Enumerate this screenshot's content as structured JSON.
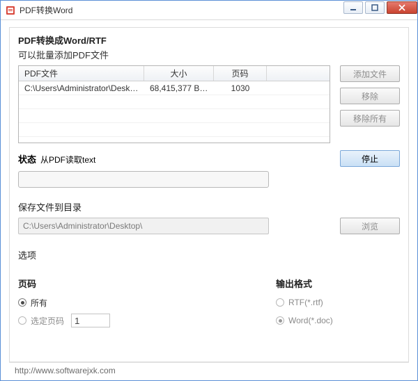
{
  "window": {
    "title": "PDF转换Word"
  },
  "header": {
    "title": "PDF转换成Word/RTF",
    "subtitle": "可以批量添加PDF文件"
  },
  "table": {
    "columns": {
      "file": "PDF文件",
      "size": "大小",
      "page": "页码"
    },
    "rows": [
      {
        "file": "C:\\Users\\Administrator\\Deskto...",
        "size": "68,415,377 Byte",
        "page": "1030"
      }
    ]
  },
  "buttons": {
    "add": "添加文件",
    "remove": "移除",
    "removeAll": "移除所有",
    "stop": "停止",
    "browse": "浏览"
  },
  "status": {
    "label": "状态",
    "text": "从PDF读取text"
  },
  "save": {
    "label": "保存文件到目录",
    "path": "C:\\Users\\Administrator\\Desktop\\"
  },
  "options": {
    "section": "选项",
    "page": {
      "title": "页码",
      "all": "所有",
      "selected": "选定页码",
      "value": "1"
    },
    "format": {
      "title": "输出格式",
      "rtf": "RTF(*.rtf)",
      "word": "Word(*.doc)"
    }
  },
  "footer": {
    "url": "http://www.softwarejxk.com"
  }
}
